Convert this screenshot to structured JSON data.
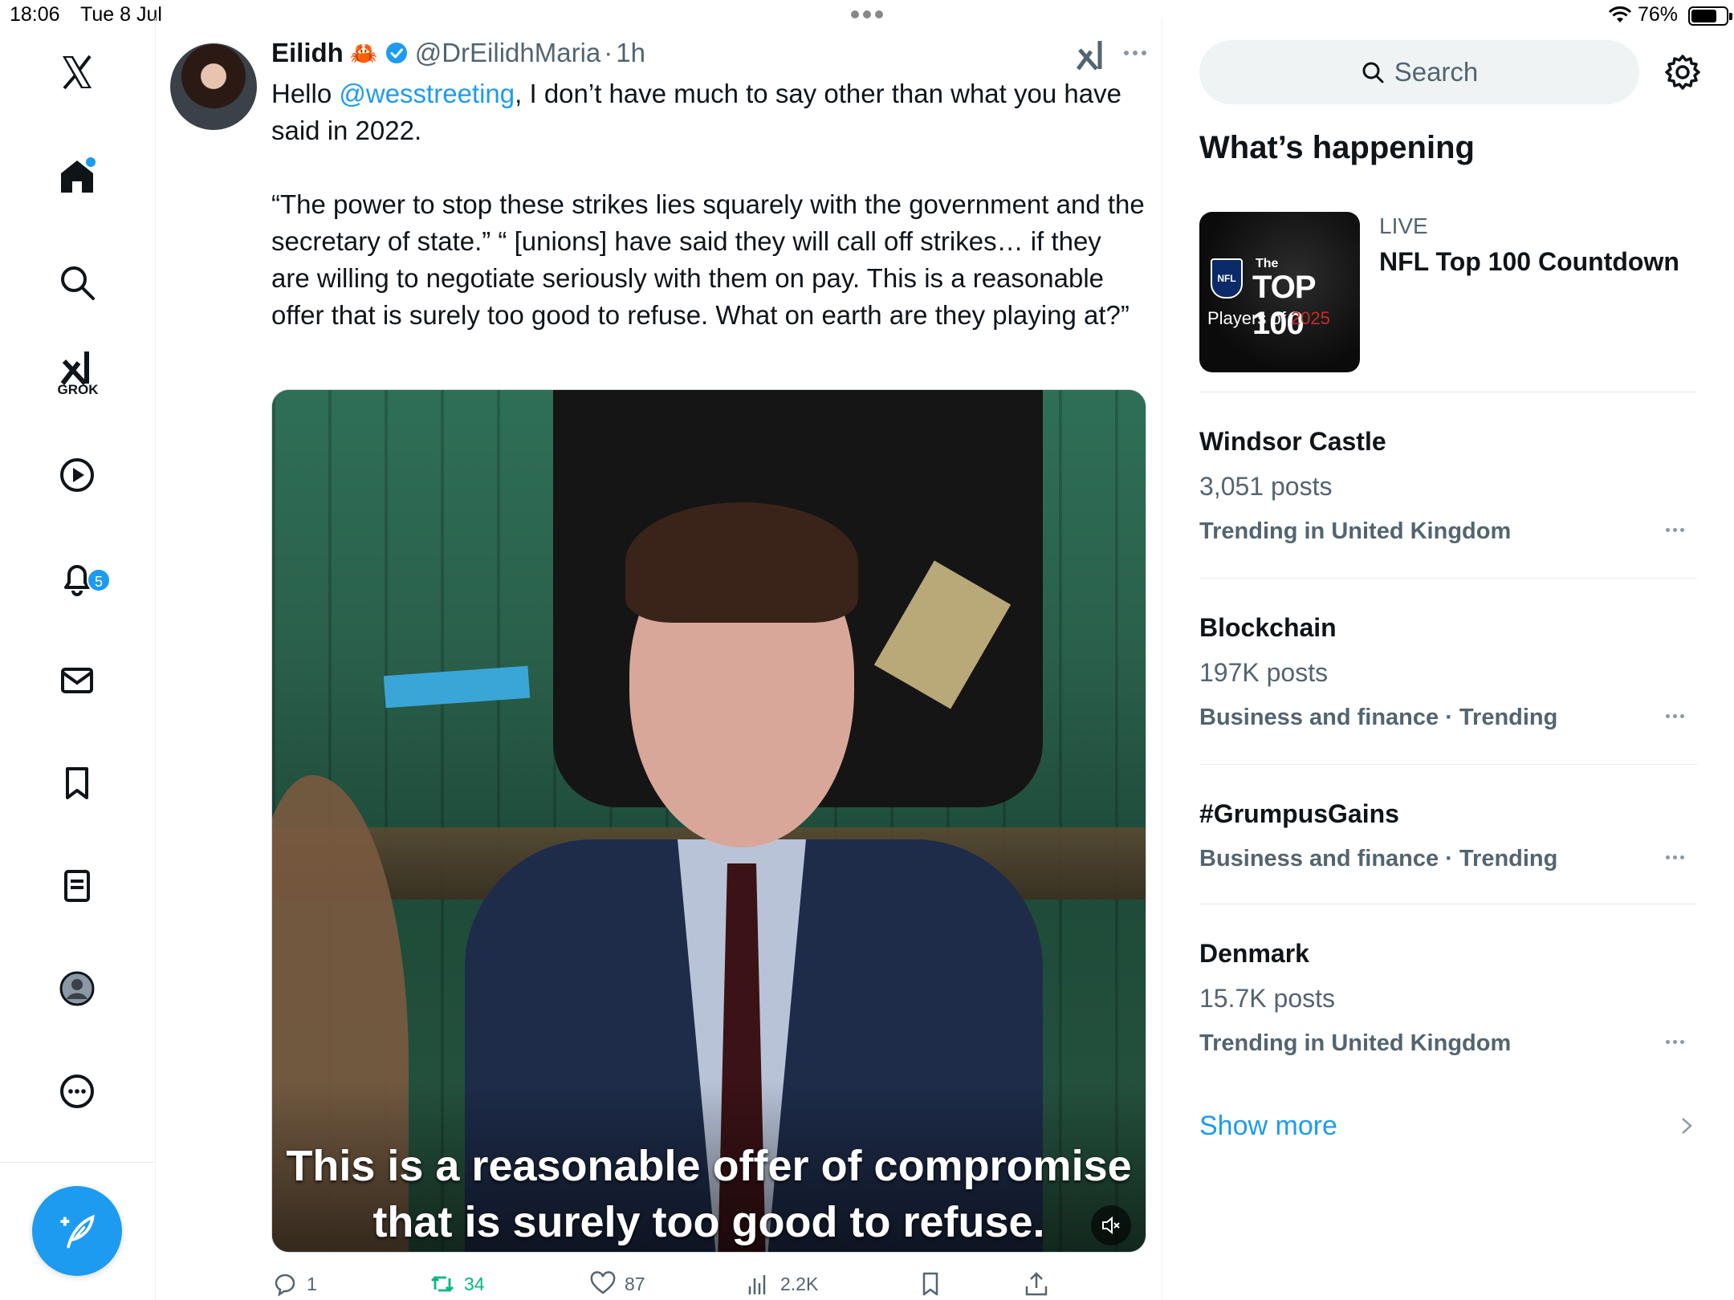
{
  "status_bar": {
    "time": "18:06",
    "date": "Tue 8 Jul",
    "battery": "76%"
  },
  "nav": {
    "grok_label": "GROK",
    "notifications_badge": "5"
  },
  "post": {
    "display_name": "Eilidh",
    "name_emoji": "🦀",
    "handle": "@DrEilidhMaria",
    "separator": "·",
    "time_ago": "1h",
    "text_prefix": "Hello ",
    "mention": "@wesstreeting",
    "text_line1_rest": ", I don’t have much to say other than what you have said in 2022.",
    "quote": "“The power to stop these strikes lies squarely with the government and the secretary of state.” “ [unions] have said they will call off strikes… if they are willing to negotiate seriously with them on pay. This is a reasonable offer that is surely too good to refuse. What on earth are they playing at?”",
    "video_caption_line1": "This is a reasonable offer of compromise",
    "video_caption_line2": "that is surely too good to refuse.",
    "stats": {
      "replies": "1",
      "reposts": "34",
      "likes": "87",
      "views": "2.2K"
    }
  },
  "sidebar": {
    "search_placeholder": "Search",
    "section_title": "What’s happening",
    "live": {
      "label": "LIVE",
      "title": "NFL Top 100 Countdown",
      "thumb_the": "The",
      "thumb_top": "TOP 100",
      "thumb_players": "Players of ",
      "thumb_year": "2025",
      "thumb_shield": "NFL"
    },
    "trends": [
      {
        "title": "Windsor Castle",
        "count": "3,051 posts",
        "context": "Trending in United Kingdom"
      },
      {
        "title": "Blockchain",
        "count": "197K posts",
        "context": "Business and finance · Trending"
      },
      {
        "title": "#GrumpusGains",
        "context": "Business and finance · Trending"
      },
      {
        "title": "Denmark",
        "count": "15.7K posts",
        "context": "Trending in United Kingdom"
      }
    ],
    "show_more": "Show more"
  },
  "colors": {
    "accent": "#1d9bf0",
    "repost_green": "#00ba7c",
    "secondary_text": "#536471"
  }
}
